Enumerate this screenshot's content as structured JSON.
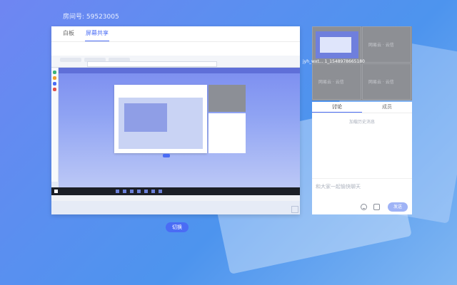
{
  "room": {
    "label": "房间号: 59523005"
  },
  "main": {
    "tabs": [
      {
        "label": "白板"
      },
      {
        "label": "屏幕共享"
      }
    ],
    "active_tab": "屏幕共享"
  },
  "switch_button": {
    "label": "切换"
  },
  "video": {
    "user_id": "jyh_wxt... 1_1548978665180",
    "watermark": "网易云 · 云信"
  },
  "chat": {
    "tabs": [
      {
        "label": "讨论"
      },
      {
        "label": "成员"
      }
    ],
    "history_link": "加载历史消息",
    "input_placeholder": "和大家一起愉快聊天",
    "send_label": "发送"
  },
  "colors": {
    "accent": "#4a6cf5",
    "send_disabled": "#9fb3f6",
    "video_bg": "#8a8c91"
  }
}
